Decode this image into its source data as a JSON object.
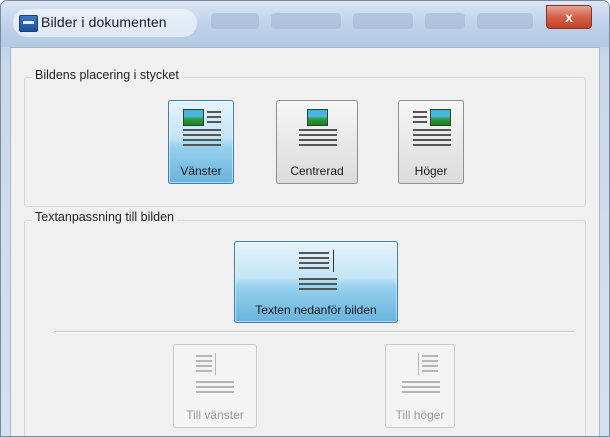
{
  "window": {
    "title": "Bilder i dokumenten",
    "close_glyph": "x",
    "icons": {
      "app": "app-window-icon",
      "close": "close-icon"
    }
  },
  "placement_group": {
    "label": "Bildens placering i stycket",
    "options": [
      {
        "label": "Vänster",
        "icon": "image-left-icon",
        "selected": true
      },
      {
        "label": "Centrerad",
        "icon": "image-center-icon",
        "selected": false
      },
      {
        "label": "Höger",
        "icon": "image-right-icon",
        "selected": false
      }
    ]
  },
  "wrap_group": {
    "label": "Textanpassning till bilden",
    "main_option": {
      "label": "Texten nedanför bilden",
      "icon": "text-below-icon",
      "selected": true
    },
    "side_options": [
      {
        "label": "Till vänster",
        "icon": "text-left-icon",
        "enabled": false
      },
      {
        "label": "Till höger",
        "icon": "text-right-icon",
        "enabled": false
      }
    ]
  },
  "colors": {
    "selected_fill": "#68b3db",
    "selected_border": "#3c7fb1",
    "close_red": "#c4402a"
  }
}
